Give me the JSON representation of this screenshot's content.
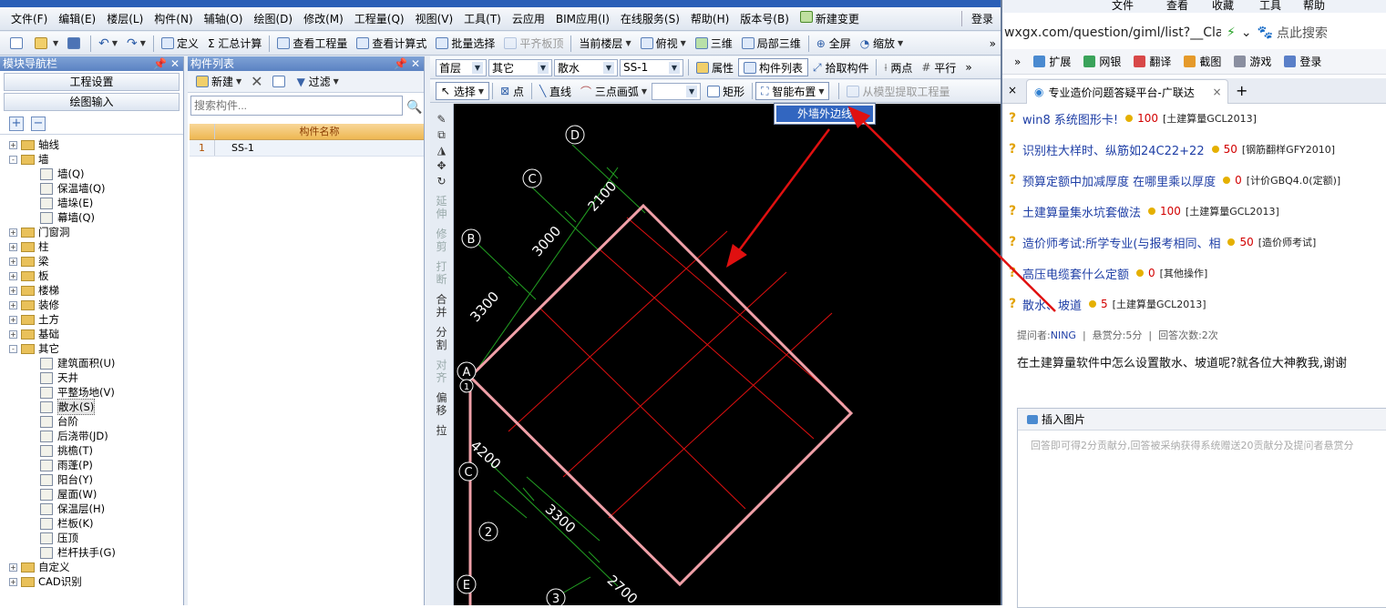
{
  "app": {
    "menu": [
      "文件(F)",
      "编辑(E)",
      "楼层(L)",
      "构件(N)",
      "辅轴(O)",
      "绘图(D)",
      "修改(M)",
      "工程量(Q)",
      "视图(V)",
      "工具(T)",
      "云应用",
      "BIM应用(I)",
      "在线服务(S)",
      "帮助(H)",
      "版本号(B)",
      "新建变更"
    ],
    "login": "登录",
    "toolbar1": {
      "define": "定义",
      "sum": "Σ 汇总计算",
      "view_qty": "查看工程量",
      "view_formula": "查看计算式",
      "batch_select": "批量选择",
      "align_slab": "平齐板顶",
      "cur_floor": "当前楼层",
      "topview": "俯视",
      "threeD": "三维",
      "local3d": "局部三维",
      "fullscreen": "全屏",
      "zoom": "缩放"
    },
    "nav": {
      "title": "模块导航栏",
      "btn_project": "工程设置",
      "btn_draw": "绘图输入",
      "tree": [
        {
          "label": "轴线",
          "level": 1,
          "expand": "+"
        },
        {
          "label": "墙",
          "level": 1,
          "expand": "-"
        },
        {
          "label": "墙(Q)",
          "level": 2
        },
        {
          "label": "保温墙(Q)",
          "level": 2
        },
        {
          "label": "墙垛(E)",
          "level": 2
        },
        {
          "label": "幕墙(Q)",
          "level": 2
        },
        {
          "label": "门窗洞",
          "level": 1,
          "expand": "+"
        },
        {
          "label": "柱",
          "level": 1,
          "expand": "+"
        },
        {
          "label": "梁",
          "level": 1,
          "expand": "+"
        },
        {
          "label": "板",
          "level": 1,
          "expand": "+"
        },
        {
          "label": "楼梯",
          "level": 1,
          "expand": "+"
        },
        {
          "label": "装修",
          "level": 1,
          "expand": "+"
        },
        {
          "label": "土方",
          "level": 1,
          "expand": "+"
        },
        {
          "label": "基础",
          "level": 1,
          "expand": "+"
        },
        {
          "label": "其它",
          "level": 1,
          "expand": "-"
        },
        {
          "label": "建筑面积(U)",
          "level": 2
        },
        {
          "label": "天井",
          "level": 2
        },
        {
          "label": "平整场地(V)",
          "level": 2
        },
        {
          "label": "散水(S)",
          "level": 2,
          "selected": true
        },
        {
          "label": "台阶",
          "level": 2
        },
        {
          "label": "后浇带(JD)",
          "level": 2
        },
        {
          "label": "挑檐(T)",
          "level": 2
        },
        {
          "label": "雨蓬(P)",
          "level": 2
        },
        {
          "label": "阳台(Y)",
          "level": 2
        },
        {
          "label": "屋面(W)",
          "level": 2
        },
        {
          "label": "保温层(H)",
          "level": 2
        },
        {
          "label": "栏板(K)",
          "level": 2
        },
        {
          "label": "压顶",
          "level": 2
        },
        {
          "label": "栏杆扶手(G)",
          "level": 2
        },
        {
          "label": "自定义",
          "level": 1,
          "expand": "+"
        },
        {
          "label": "CAD识别",
          "level": 1,
          "expand": "+"
        }
      ]
    },
    "complist": {
      "title": "构件列表",
      "new": "新建",
      "filter": "过滤",
      "search_placeholder": "搜索构件...",
      "col_header": "构件名称",
      "rows": [
        {
          "num": "1",
          "name": "SS-1"
        }
      ]
    },
    "tb2": {
      "floor": "首层",
      "type": "其它",
      "sub": "散水",
      "comp": "SS-1",
      "prop": "属性",
      "complist": "构件列表",
      "pick": "拾取构件",
      "twopoint": "两点",
      "parallel": "平行"
    },
    "tb3": {
      "select": "选择",
      "point": "点",
      "line": "直线",
      "arc3": "三点画弧",
      "rect": "矩形",
      "smart": "智能布置",
      "extract": "从模型提取工程量"
    },
    "popup_item": "外墙外边线",
    "side_tools": [
      "延伸",
      "修剪",
      "打断",
      "合并",
      "分割",
      "对齐",
      "偏移",
      "拉"
    ],
    "canvas": {
      "axis_labels": [
        "D",
        "C",
        "B",
        "A",
        "1",
        "C",
        "2",
        "E",
        "3"
      ],
      "dims": [
        "2100",
        "3000",
        "3300",
        "4200",
        "3300",
        "2700"
      ]
    }
  },
  "browser": {
    "top": {
      "file": "文件",
      "view": "查看",
      "fav": "收藏",
      "tools": "工具",
      "help": "帮助"
    },
    "url": "wxgx.com/question/giml/list?__ClassCc",
    "search_placeholder": "点此搜索",
    "favbar": [
      "扩展",
      "网银",
      "翻译",
      "截图",
      "游戏",
      "登录"
    ],
    "tab_title": "专业造价问题答疑平台-广联达",
    "tab_close": "×",
    "tab_new": "+",
    "questions": [
      {
        "title": "win8 系统图形卡!",
        "points": "100",
        "cat": "[土建算量GCL2013]"
      },
      {
        "title": "识别柱大样时、纵筋如24C22+22",
        "points": "50",
        "cat": "[钢筋翻样GFY2010]"
      },
      {
        "title": "预算定额中加减厚度 在哪里乘以厚度",
        "points": "0",
        "cat": "[计价GBQ4.0(定额)]"
      },
      {
        "title": "土建算量集水坑套做法",
        "points": "100",
        "cat": "[土建算量GCL2013]"
      },
      {
        "title": "造价师考试:所学专业(与报考相同、相",
        "points": "50",
        "cat": "[造价师考试]"
      },
      {
        "title": "高压电缆套什么定额",
        "points": "0",
        "cat": "[其他操作]"
      },
      {
        "title": "散水、坡道",
        "points": "5",
        "cat": "[土建算量GCL2013]"
      }
    ],
    "meta": {
      "asker_label": "提问者:",
      "asker": "NING",
      "reward": "悬赏分:5分",
      "answers": "回答次数:2次"
    },
    "question_text": "在土建算量软件中怎么设置散水、坡道呢?就各位大神教我,谢谢",
    "answer": {
      "insert_image": "插入图片",
      "placeholder": "回答即可得2分贡献分,回答被采纳获得系统赠送20贡献分及提问者悬赏分"
    }
  },
  "colors": {
    "arrow": "#e01010",
    "wall": "#f0a0a8",
    "gridline": "#e01010",
    "dim": "#22a022"
  }
}
